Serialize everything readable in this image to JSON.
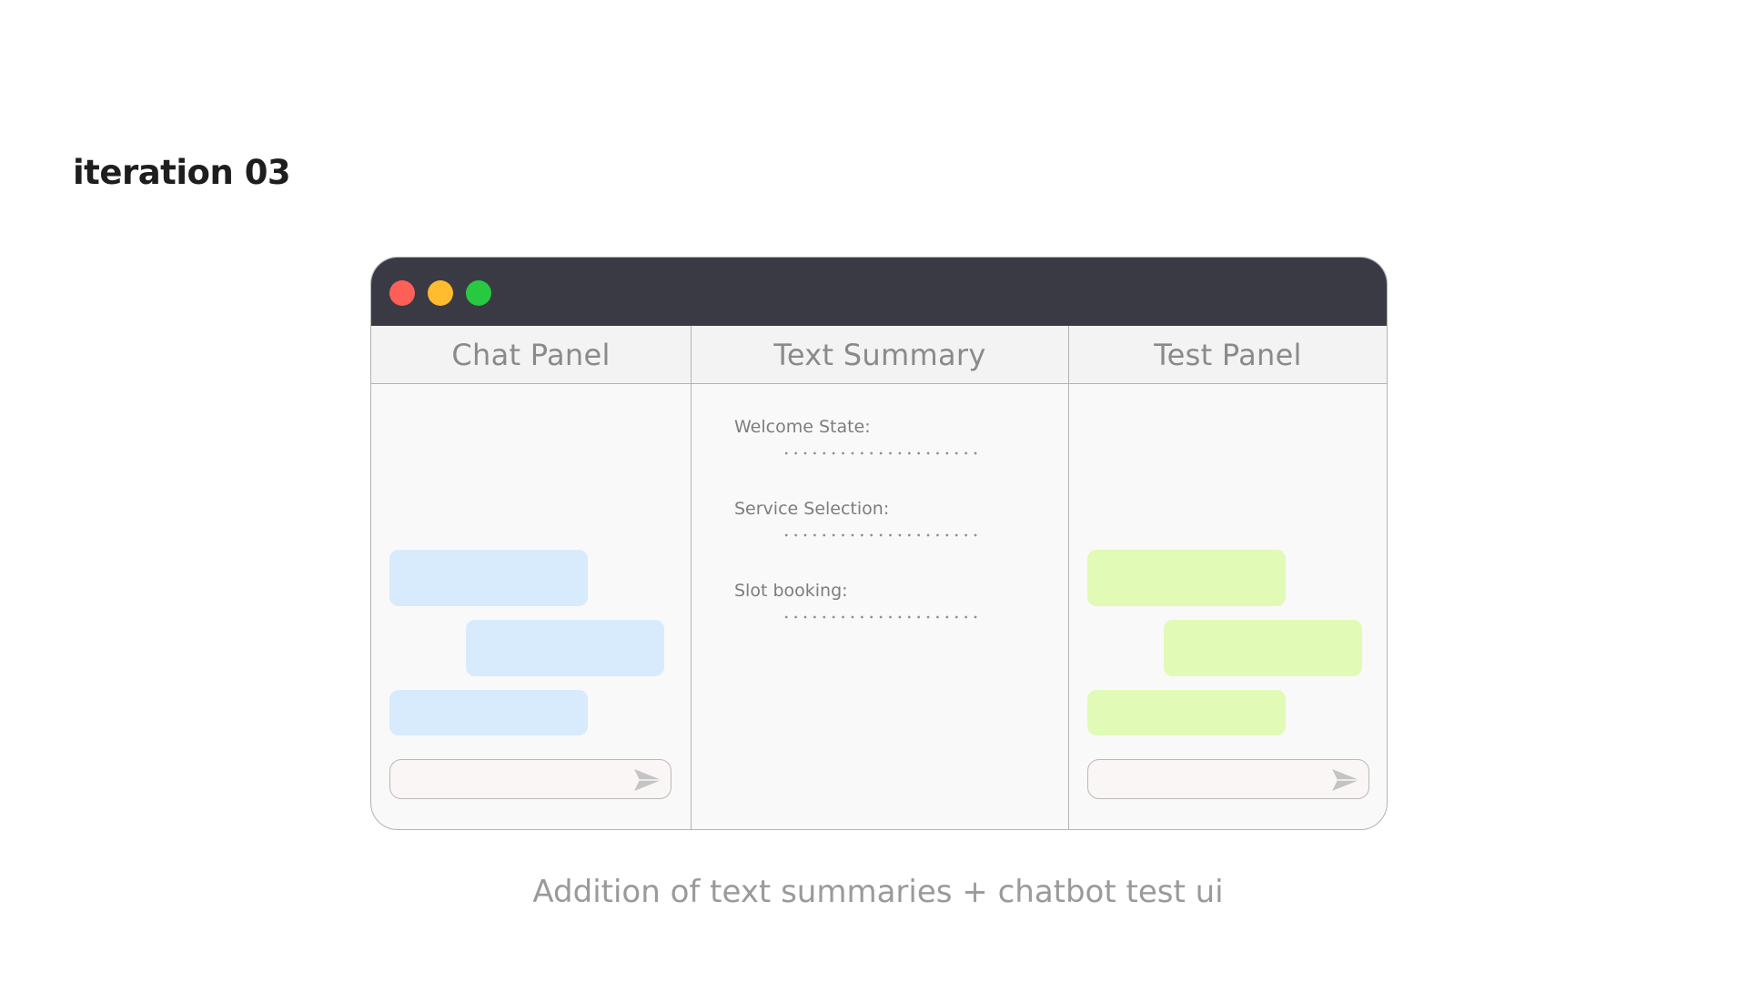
{
  "title": "iteration 03",
  "window": {
    "controls": [
      "close-dot",
      "minimize-dot",
      "maximize-dot"
    ],
    "panels": {
      "chat": {
        "label": "Chat Panel",
        "bubble_color": "#d8ebfc"
      },
      "summary": {
        "label": "Text Summary",
        "items": [
          {
            "label": "Welcome State:",
            "value": "......................"
          },
          {
            "label": "Service Selection:",
            "value": "......................"
          },
          {
            "label": "Slot booking:",
            "value": "......................"
          }
        ]
      },
      "test": {
        "label": "Test Panel",
        "bubble_color": "#e1fbb6"
      }
    }
  },
  "caption": "Addition of text summaries + chatbot test ui",
  "colors": {
    "titlebar": "#3a3a44",
    "close": "#fe5f57",
    "minimize": "#febc2e",
    "maximize": "#28c840"
  },
  "icons": {
    "send": "send-icon"
  }
}
